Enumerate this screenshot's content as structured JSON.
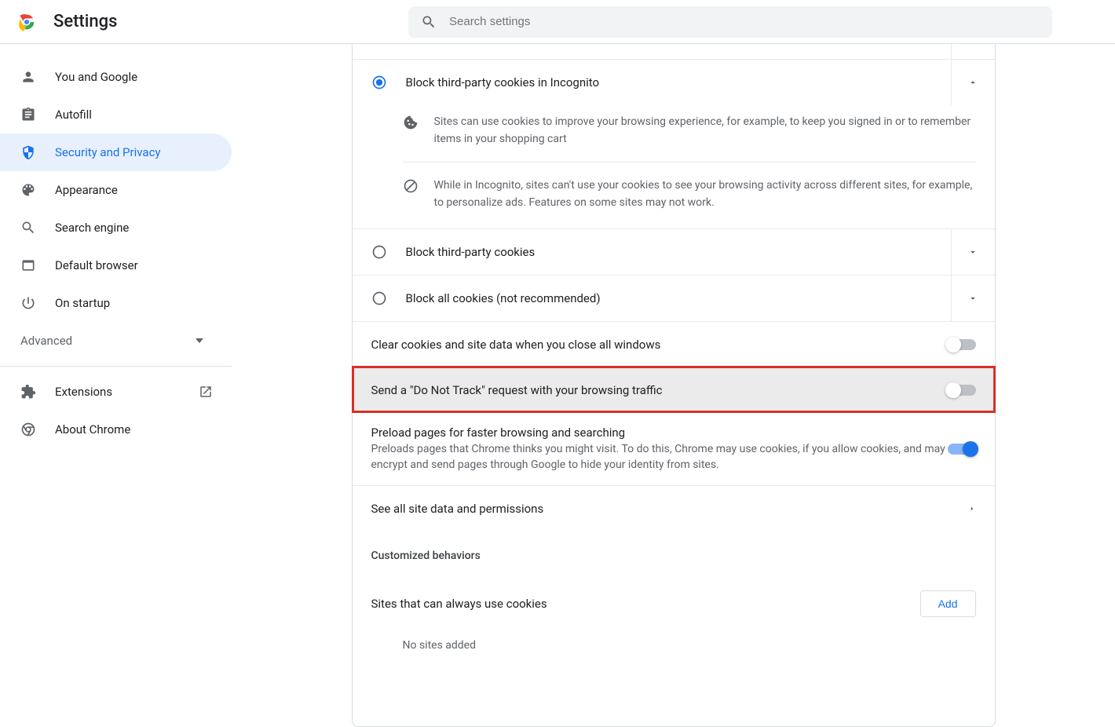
{
  "header": {
    "title": "Settings",
    "search_placeholder": "Search settings"
  },
  "sidebar": {
    "items": [
      {
        "label": "You and Google"
      },
      {
        "label": "Autofill"
      },
      {
        "label": "Security and Privacy"
      },
      {
        "label": "Appearance"
      },
      {
        "label": "Search engine"
      },
      {
        "label": "Default browser"
      },
      {
        "label": "On startup"
      }
    ],
    "advanced_label": "Advanced",
    "extensions_label": "Extensions",
    "about_label": "About Chrome"
  },
  "cookies": {
    "option_incognito": "Block third-party cookies in Incognito",
    "option_third_party": "Block third-party cookies",
    "option_all": "Block all cookies (not recommended)",
    "info_cookie": "Sites can use cookies to improve your browsing experience, for example, to keep you signed in or to remember items in your shopping cart",
    "info_block": "While in Incognito, sites can't use your cookies to see your browsing activity across different sites, for example, to personalize ads. Features on some sites may not work."
  },
  "toggles": {
    "clear_on_close": "Clear cookies and site data when you close all windows",
    "dnt": "Send a \"Do Not Track\" request with your browsing traffic",
    "preload_title": "Preload pages for faster browsing and searching",
    "preload_sub": "Preloads pages that Chrome thinks you might visit. To do this, Chrome may use cookies, if you allow cookies, and may encrypt and send pages through Google to hide your identity from sites."
  },
  "links": {
    "site_data": "See all site data and permissions"
  },
  "custom": {
    "header": "Customized behaviors",
    "always_label": "Sites that can always use cookies",
    "add_label": "Add",
    "empty_label": "No sites added"
  }
}
